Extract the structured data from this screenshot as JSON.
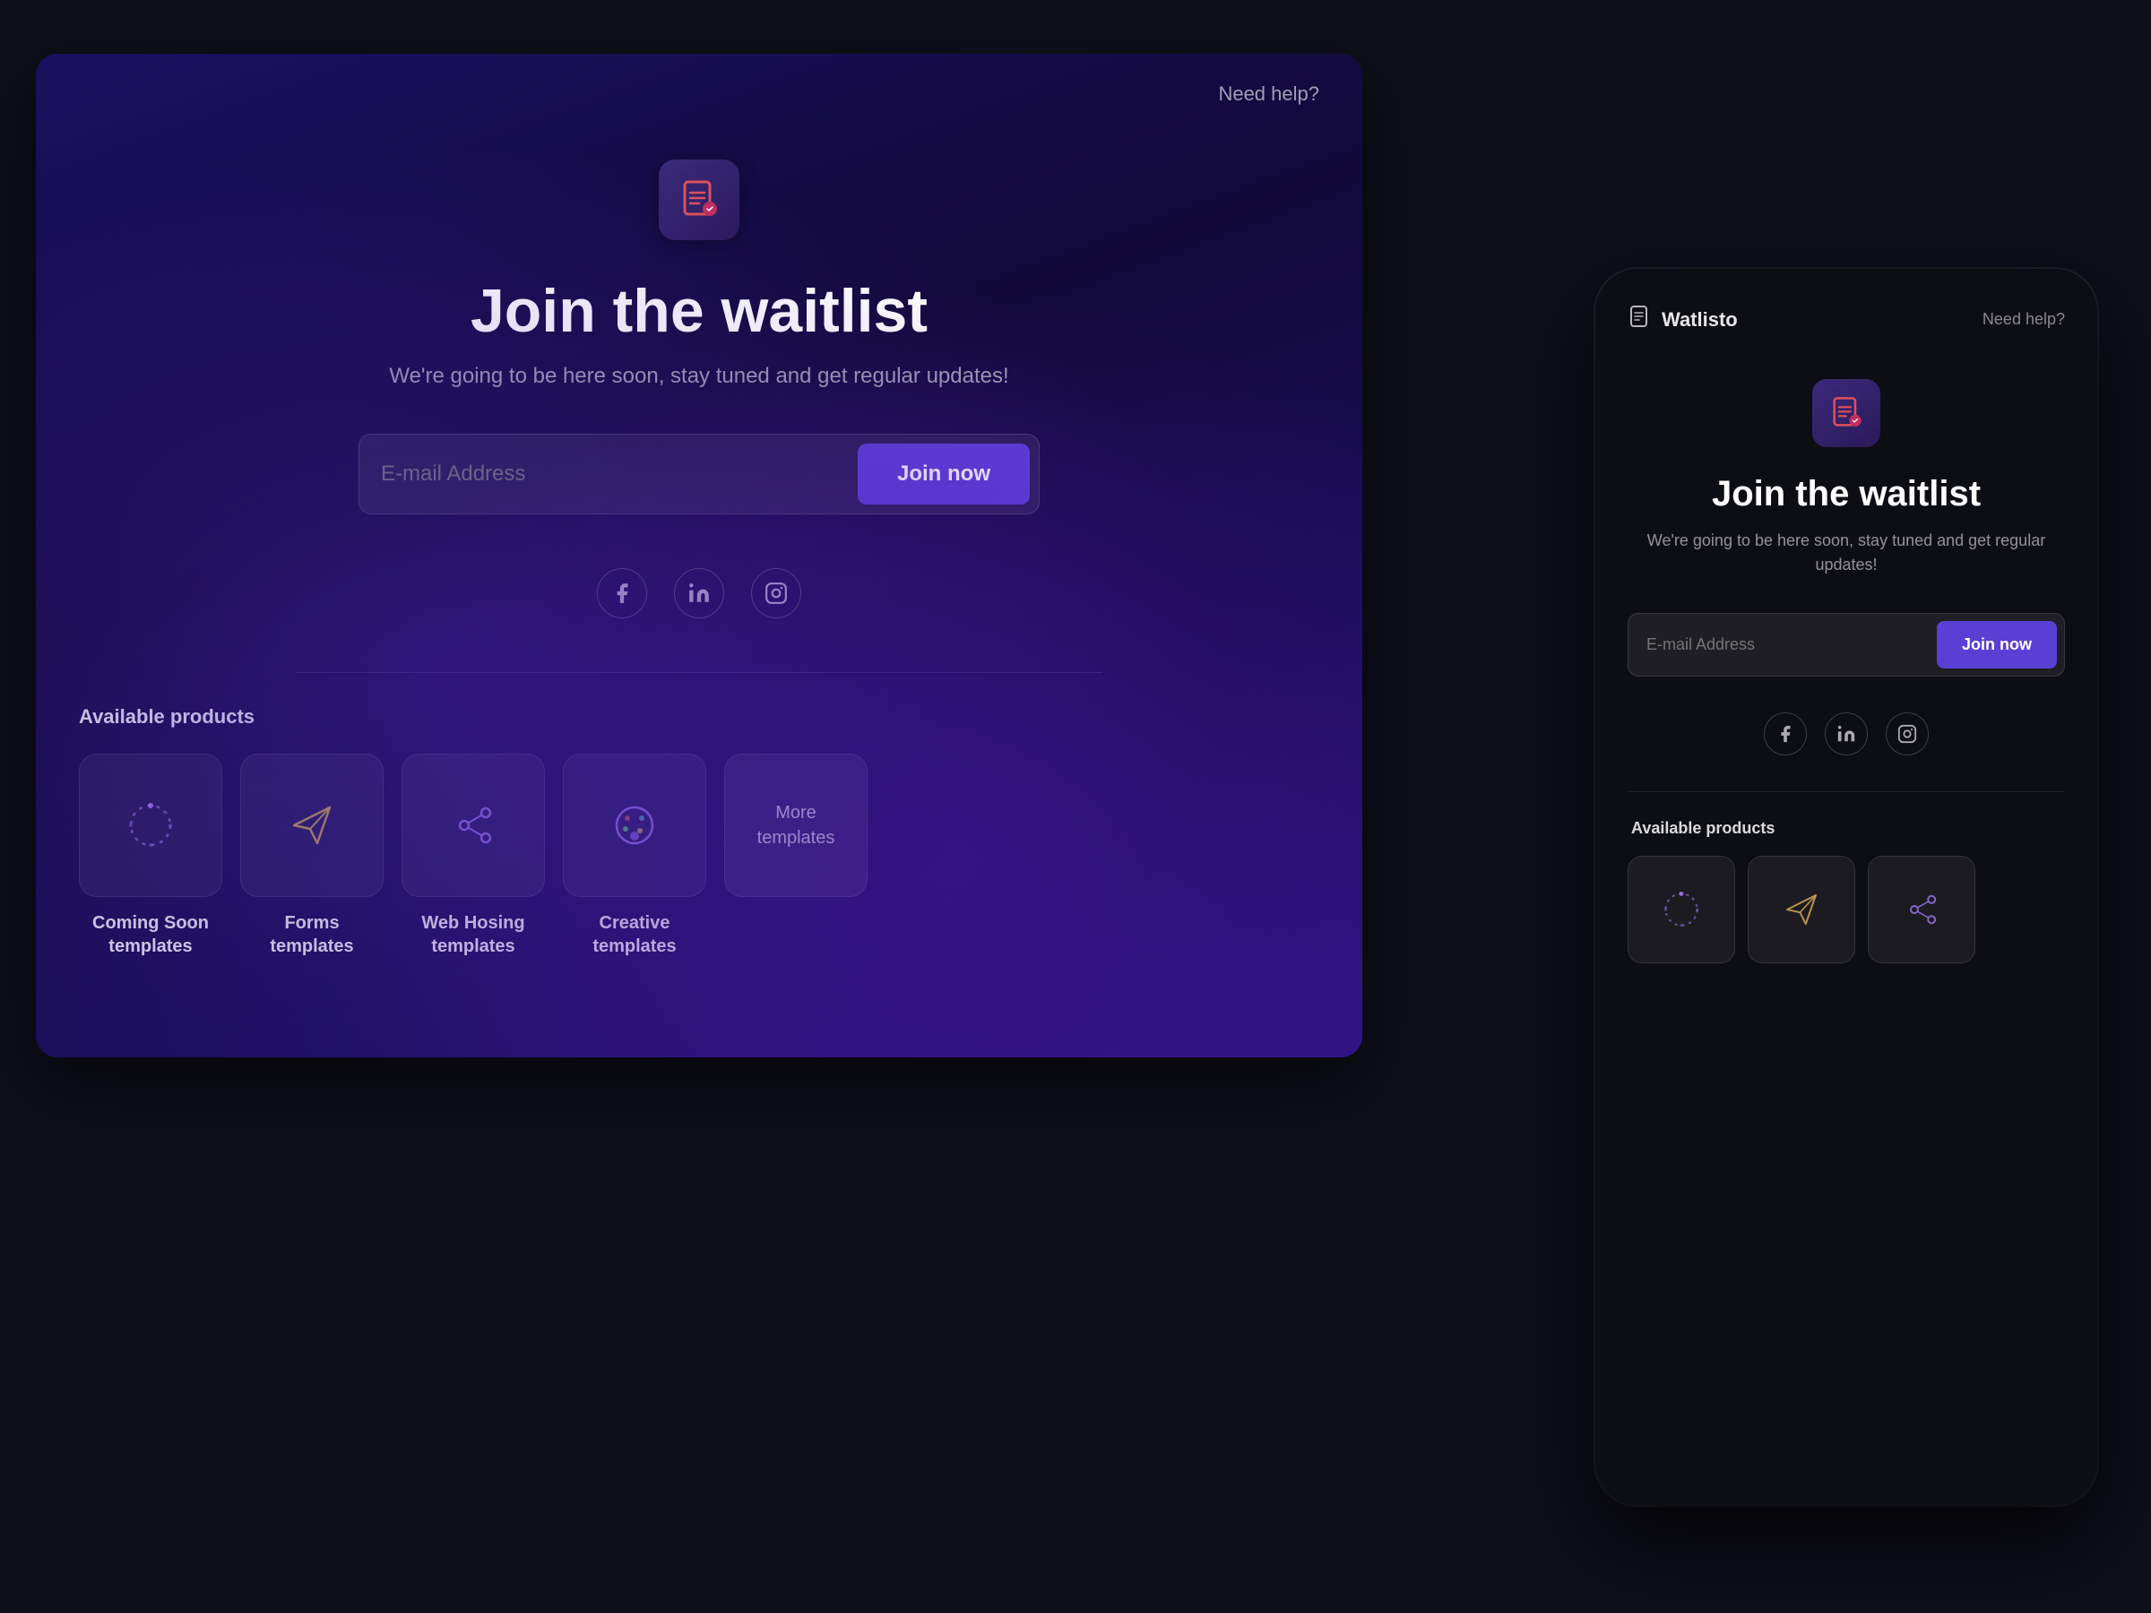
{
  "scene": {
    "background": "#0f0f1a"
  },
  "desktop": {
    "need_help": "Need help?",
    "title": "Join the waitlist",
    "subtitle": "We're going to be here soon, stay tuned and get regular updates!",
    "email_placeholder": "E-mail Address",
    "join_button": "Join now",
    "available_products_label": "Available products",
    "products": [
      {
        "id": "coming-soon",
        "label": "Coming Soon\ntemplates",
        "icon": "loader"
      },
      {
        "id": "forms",
        "label": "Forms\ntemplates",
        "icon": "send"
      },
      {
        "id": "web-hosing",
        "label": "Web Hosing\ntemplates",
        "icon": "share"
      },
      {
        "id": "creative",
        "label": "Creative\ntemplates",
        "icon": "palette"
      },
      {
        "id": "more",
        "label": "More\ntemplates",
        "icon": "more"
      }
    ]
  },
  "mobile": {
    "logo_text": "Watlisto",
    "need_help": "Need help?",
    "title": "Join the waitlist",
    "subtitle": "We're going to be here soon, stay tuned and get regular updates!",
    "email_placeholder": "E-mail Address",
    "join_button": "Join now",
    "available_products_label": "Available products"
  }
}
